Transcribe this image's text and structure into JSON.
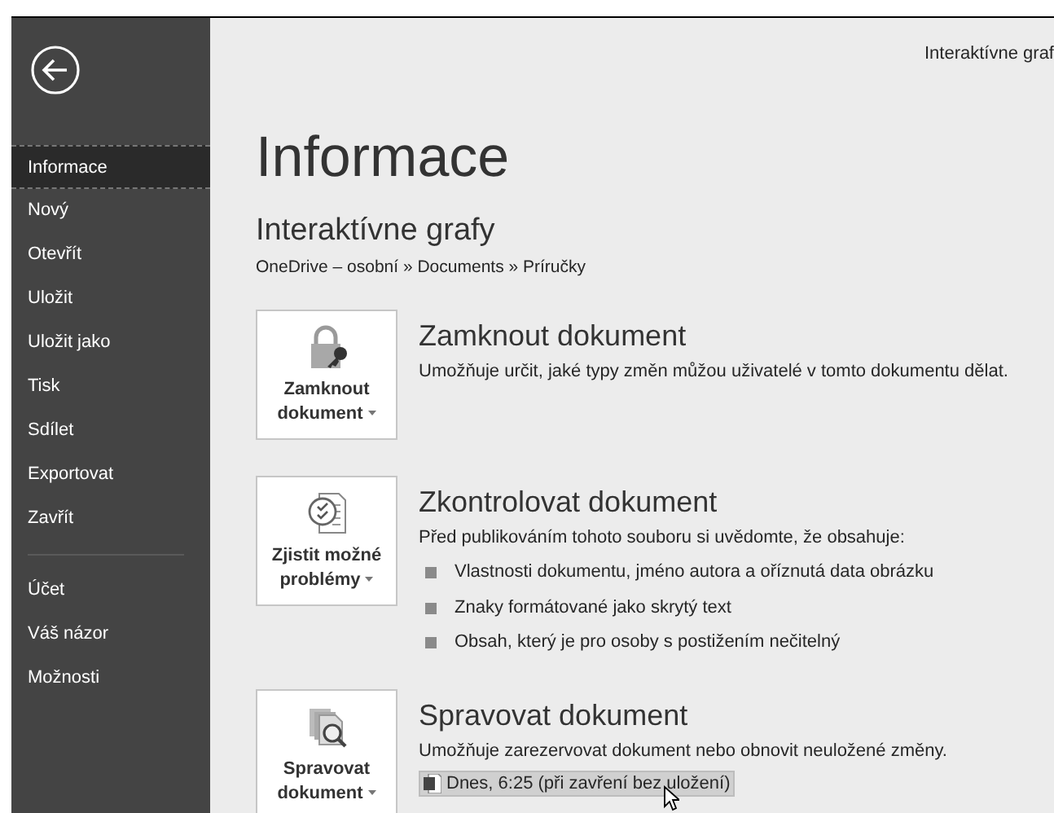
{
  "window": {
    "title": "Interaktívne graf"
  },
  "sidebar": {
    "items": [
      {
        "label": "Informace",
        "selected": true
      },
      {
        "label": "Nový",
        "selected": false
      },
      {
        "label": "Otevřít",
        "selected": false
      },
      {
        "label": "Uložit",
        "selected": false
      },
      {
        "label": "Uložit jako",
        "selected": false
      },
      {
        "label": "Tisk",
        "selected": false
      },
      {
        "label": "Sdílet",
        "selected": false
      },
      {
        "label": "Exportovat",
        "selected": false
      },
      {
        "label": "Zavřít",
        "selected": false
      }
    ],
    "footer_items": [
      {
        "label": "Účet",
        "selected": false
      },
      {
        "label": "Váš názor",
        "selected": false
      },
      {
        "label": "Možnosti",
        "selected": false
      }
    ]
  },
  "page": {
    "title": "Informace",
    "document_name": "Interaktívne grafy",
    "path": "OneDrive – osobní » Documents » Príručky"
  },
  "sections": [
    {
      "button": [
        "Zamknout",
        "dokument"
      ],
      "heading": "Zamknout dokument",
      "description": "Umožňuje určit, jaké typy změn můžou uživatelé v tomto dokumentu dělat."
    },
    {
      "button": [
        "Zjistit možné",
        "problémy"
      ],
      "heading": "Zkontrolovat dokument",
      "description": "Před publikováním tohoto souboru si uvědomte, že obsahuje:",
      "bullets": [
        "Vlastnosti dokumentu, jméno autora a oříznutá data obrázku",
        "Znaky formátované jako skrytý text",
        "Obsah, který je pro osoby s postižením nečitelný"
      ]
    },
    {
      "button": [
        "Spravovat",
        "dokument"
      ],
      "heading": "Spravovat dokument",
      "description": "Umožňuje zarezervovat dokument nebo obnovit neuložené změny.",
      "versions": [
        {
          "label": "Dnes, 6:25 (při zavření bez uložení)",
          "hovered": true
        }
      ]
    }
  ]
}
